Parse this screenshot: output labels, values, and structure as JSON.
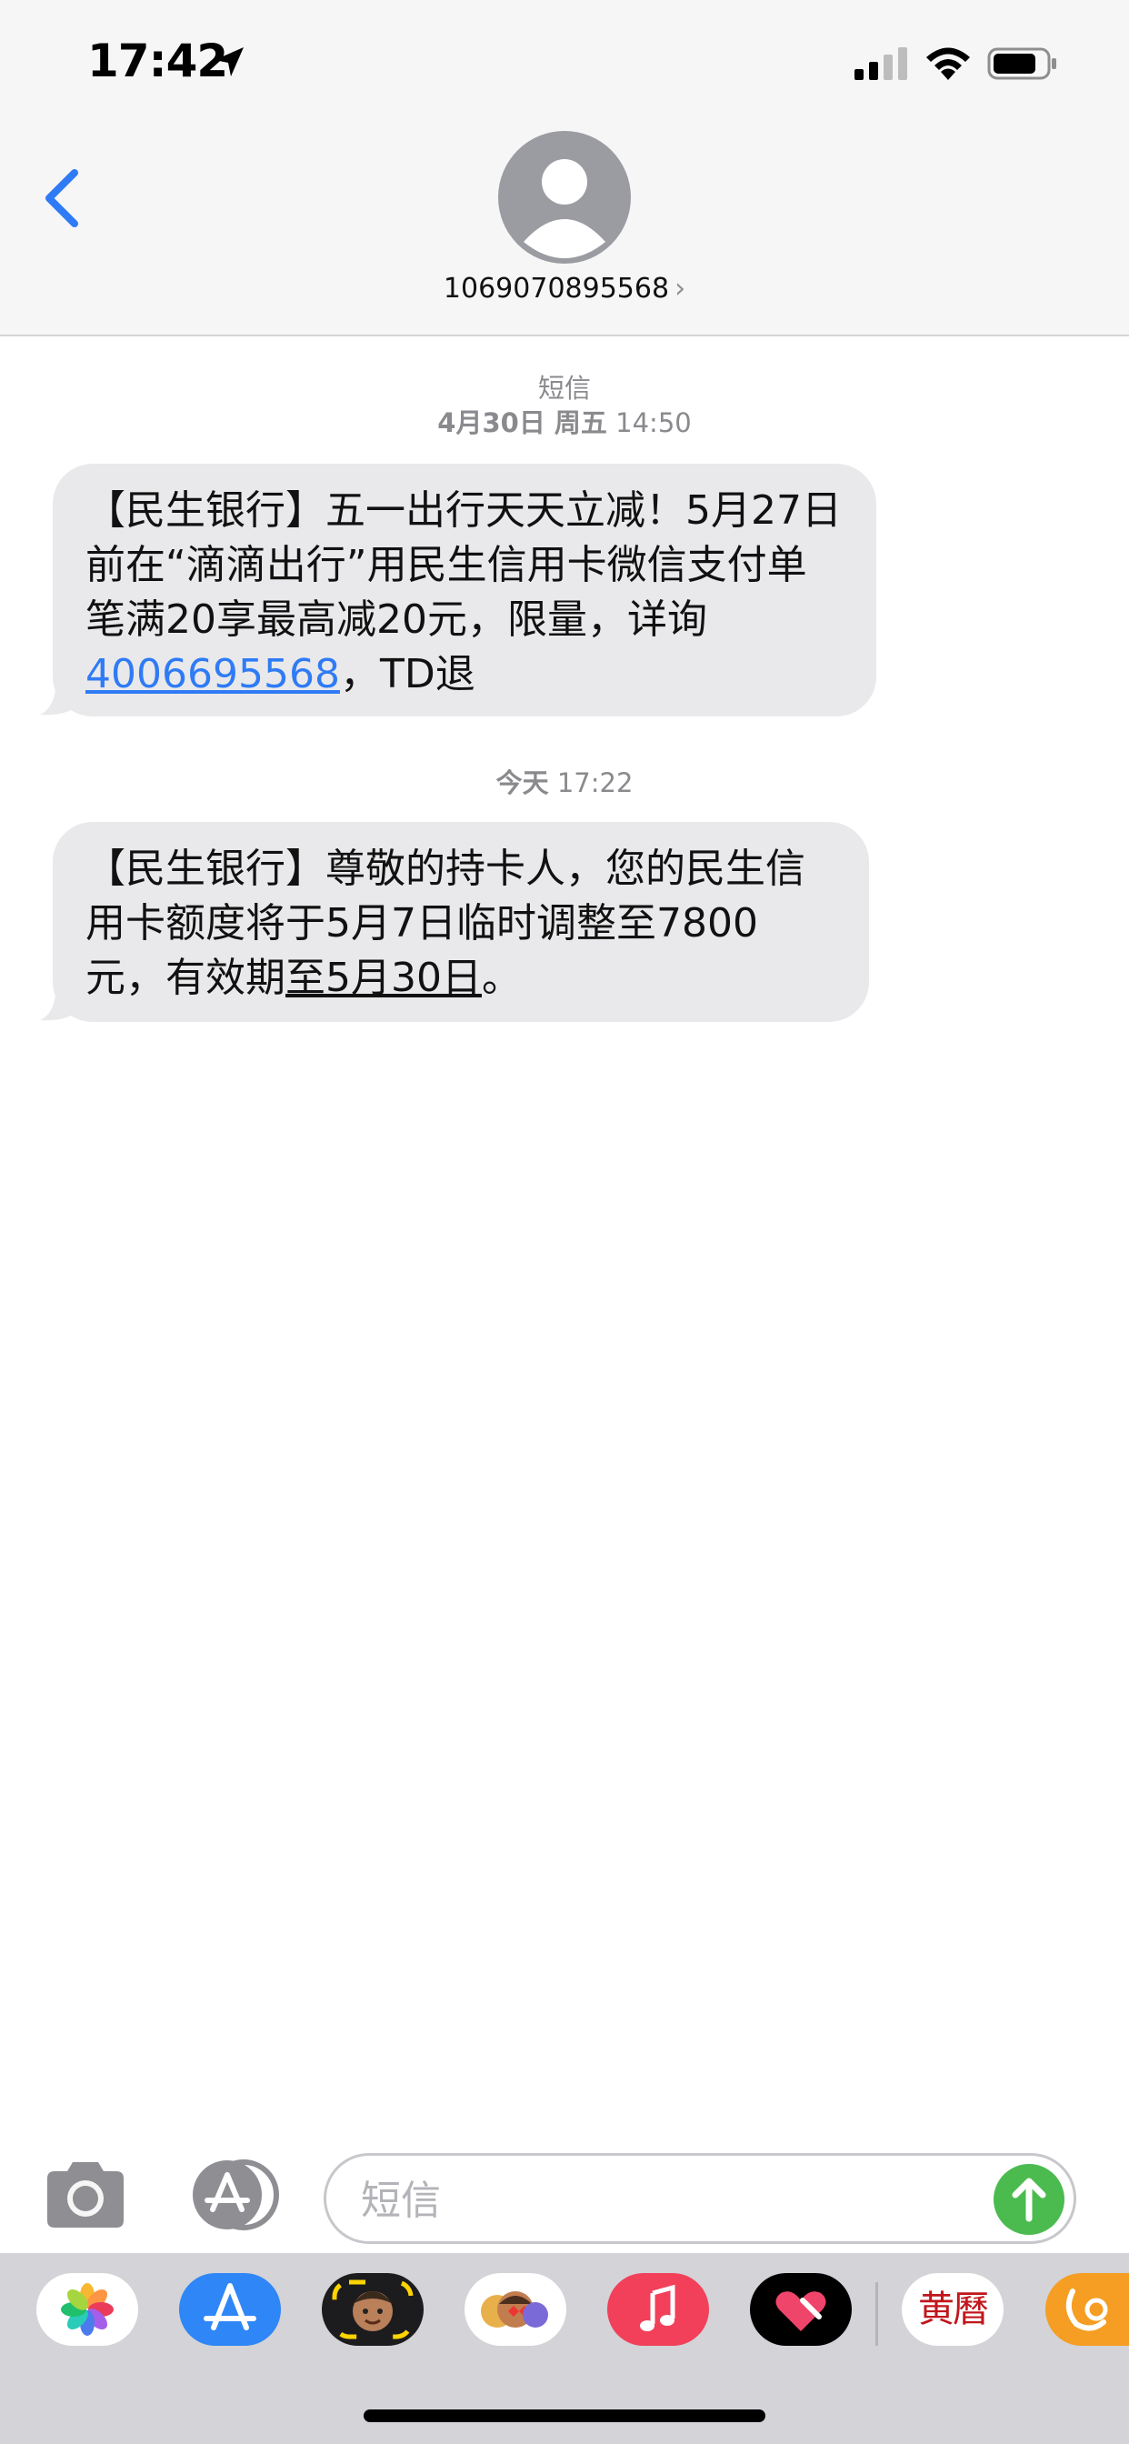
{
  "status_bar": {
    "time": "17:42"
  },
  "header": {
    "contact_number": "1069070895568"
  },
  "thread": {
    "service_label": "短信",
    "messages": [
      {
        "timestamp_date": "4月30日 周五",
        "timestamp_time": "14:50",
        "text_before_link": "【民生银行】五一出行天天立减！5月27日前在“滴滴出行”用民生信用卡微信支付单笔满20享最高减20元，限量，详询",
        "link": "4006695568",
        "text_after_link": "，TD退"
      },
      {
        "timestamp_date": "今天",
        "timestamp_time": "17:22",
        "text_before_underline": "【民生银行】尊敬的持卡人，您的民生信用卡额度将于5月7日临时调整至7800元，有效期",
        "underlined": "至5月30日",
        "text_after_underline": "。"
      }
    ]
  },
  "compose": {
    "placeholder": "短信"
  },
  "app_drawer": {
    "apps": [
      "photos-icon",
      "app-store-icon",
      "memoji-icon",
      "animoji-icon",
      "music-icon",
      "digital-touch-icon",
      "huangli-icon",
      "uc-browser-icon"
    ],
    "huangli_label": "黄曆"
  },
  "colors": {
    "link_blue": "#2f7bf5",
    "bubble_gray": "#e9e9eb",
    "send_green": "#4bbb50"
  }
}
